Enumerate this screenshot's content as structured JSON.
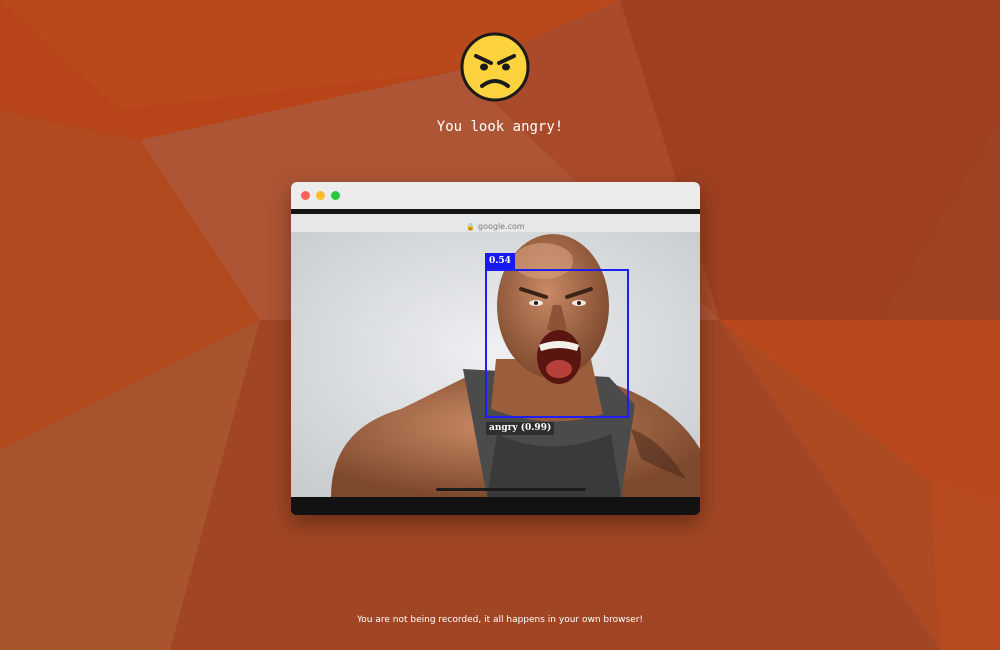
{
  "emoji": {
    "icon": "angry-face-icon",
    "face_color": "#fcd33f"
  },
  "headline": "You look angry!",
  "window": {
    "controls": [
      "close-dot",
      "minimize-dot",
      "maximize-dot"
    ],
    "url": "google.com",
    "lock_icon": "lock-icon"
  },
  "detection": {
    "score": "0.54",
    "expression": "angry (0.99)",
    "box_color": "#1e1ef5"
  },
  "footer": "You are not being recorded, it all happens in your own browser!",
  "colors": {
    "background": "#b84519",
    "titlebar": "#ececec"
  }
}
